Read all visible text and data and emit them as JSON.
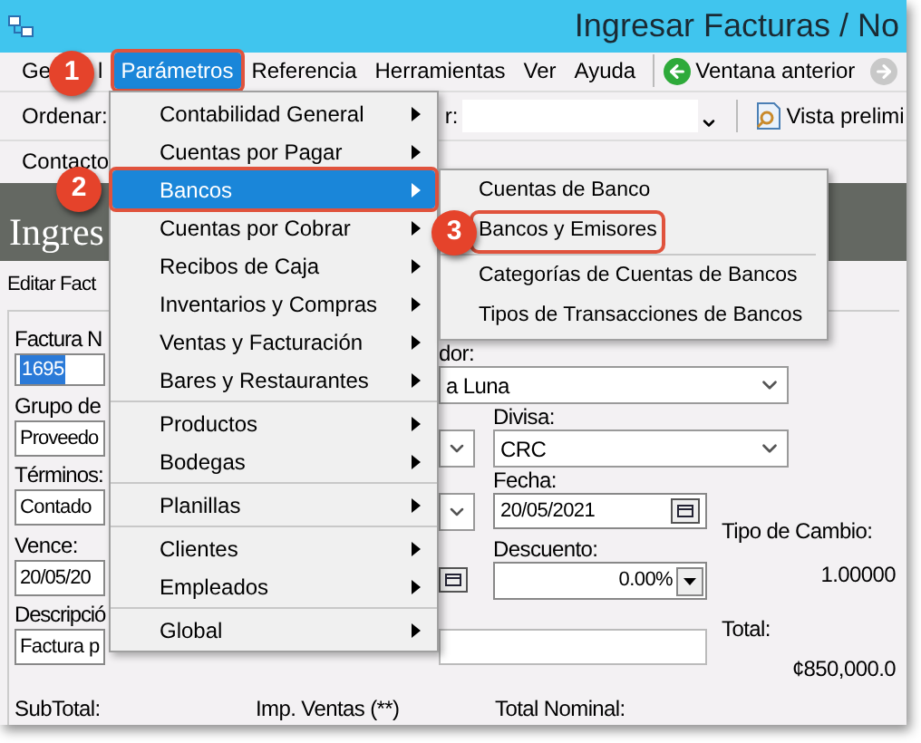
{
  "window": {
    "title": "Ingresar Facturas / No"
  },
  "menubar": [
    {
      "label_parts": [
        "Ge",
        "l"
      ],
      "selected": false
    },
    {
      "label_parts": [
        "Parámetros"
      ],
      "selected": true
    },
    {
      "label_parts": [
        "Referencia"
      ],
      "selected": false
    },
    {
      "label_parts": [
        "Herramientas"
      ],
      "selected": false
    },
    {
      "label_parts": [
        "Ver"
      ],
      "selected": false
    },
    {
      "label_parts": [
        "Ayuda"
      ],
      "selected": false
    }
  ],
  "nav": {
    "back": "Ventana anterior"
  },
  "toolbar": {
    "sort_label": "Ordenar:",
    "filter_label": "r:",
    "preview": "Vista prelimi"
  },
  "toolbar2": {
    "contacts": "Contacto"
  },
  "banner": {
    "title": "Ingres"
  },
  "tab": {
    "label": "Editar Fact"
  },
  "form": {
    "invoice_label": "Factura N",
    "invoice_value": "1695",
    "supplier_label": "dor:",
    "supplier_value": "a Luna",
    "group_label": "Grupo de",
    "group_value": "Proveedo",
    "currency_label": "Divisa:",
    "currency_value": "CRC",
    "terms_label": "Términos:",
    "terms_value": "Contado",
    "date_label": "Fecha:",
    "date_value": "20/05/2021",
    "due_label": "Vence:",
    "due_value": "20/05/20",
    "discount_label": "Descuento:",
    "discount_value": "0.00%",
    "desc_label": "Descripció",
    "desc_value": "Factura p",
    "rate_label": "Tipo de Cambio:",
    "rate_value": "1.00000",
    "total_label": "Total:",
    "total_value": "¢850,000.0",
    "subtotal_label": "SubTotal:",
    "tax_label": "Imp. Ventas (**)",
    "nominal_label": "Total Nominal:"
  },
  "menu": {
    "groups": [
      [
        {
          "label": "Contabilidad General",
          "selected": false
        },
        {
          "label": "Cuentas por Pagar",
          "selected": false
        },
        {
          "label": "Bancos",
          "selected": true
        },
        {
          "label": "Cuentas por Cobrar",
          "selected": false
        },
        {
          "label": "Recibos de Caja",
          "selected": false
        },
        {
          "label": "Inventarios y Compras",
          "selected": false
        },
        {
          "label": "Ventas y Facturación",
          "selected": false
        },
        {
          "label": "Bares y Restaurantes",
          "selected": false
        }
      ],
      [
        {
          "label": "Productos",
          "selected": false
        },
        {
          "label": "Bodegas",
          "selected": false
        }
      ],
      [
        {
          "label": "Planillas",
          "selected": false
        }
      ],
      [
        {
          "label": "Clientes",
          "selected": false
        },
        {
          "label": "Empleados",
          "selected": false
        }
      ],
      [
        {
          "label": "Global",
          "selected": false
        }
      ]
    ]
  },
  "submenu": {
    "groups": [
      [
        {
          "label": "Cuentas de Banco",
          "highlighted": false
        },
        {
          "label": "Bancos y Emisores",
          "highlighted": true
        }
      ],
      [
        {
          "label": "Categorías de Cuentas de Bancos",
          "highlighted": false
        },
        {
          "label": "Tipos de Transacciones de Bancos",
          "highlighted": false
        }
      ]
    ]
  },
  "callouts": [
    "1",
    "2",
    "3"
  ]
}
